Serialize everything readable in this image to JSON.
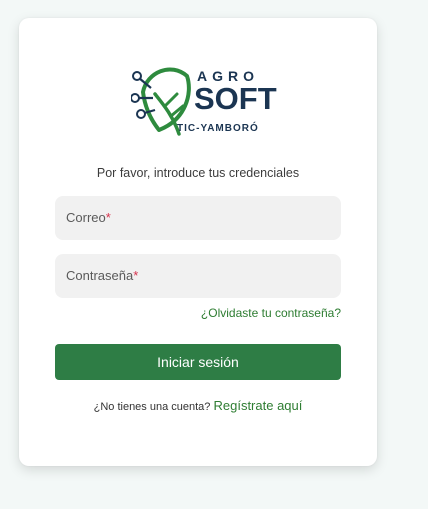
{
  "logo": {
    "agro": "AGRO",
    "soft": "SOFT",
    "sub": "TIC-YAMBORÓ"
  },
  "subtitle": "Por favor, introduce tus credenciales",
  "email_field": {
    "label": "Correo",
    "required": "*"
  },
  "password_field": {
    "label": "Contraseña",
    "required": "*"
  },
  "forgot_link": "¿Olvidaste tu contraseña?",
  "login_button": "Iniciar sesión",
  "signup": {
    "prompt": "¿No tienes una cuenta?",
    "link": "Regístrate aquí"
  },
  "colors": {
    "brand_green": "#2e7d45",
    "brand_navy": "#1b3552",
    "required": "#d6324d",
    "background": "#f3f8f7"
  }
}
